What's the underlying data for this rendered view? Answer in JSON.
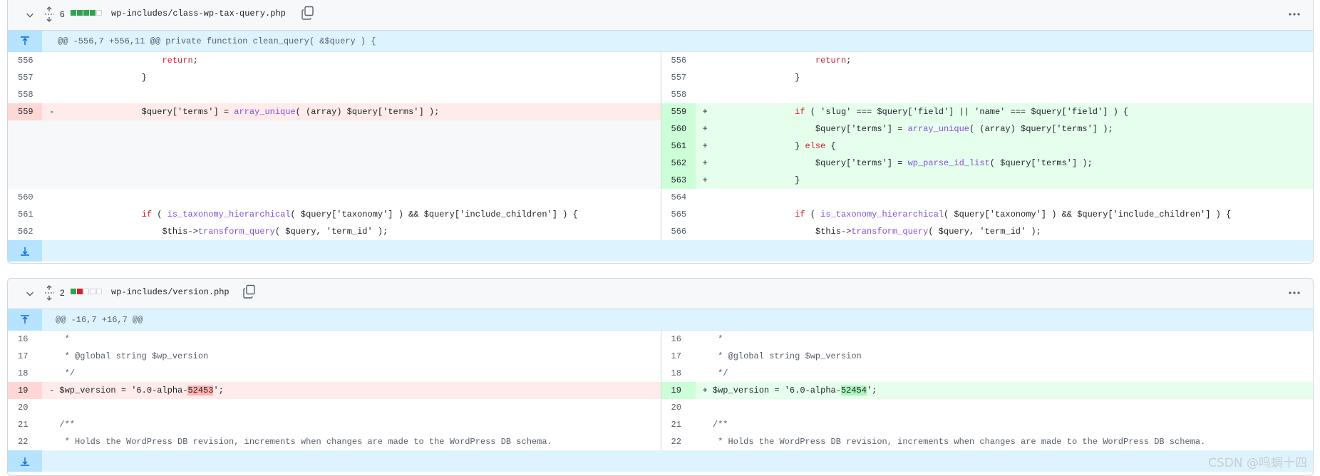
{
  "files": [
    {
      "change_count": "6",
      "stat_blocks": [
        "add",
        "add",
        "add",
        "add",
        "neutral"
      ],
      "filename": "wp-includes/class-wp-tax-query.php",
      "hunk_header": "@@ -556,7 +556,11 @@ private function clean_query( &$query ) {",
      "left_rows": [
        {
          "num": "556",
          "type": "ctx",
          "sign": "",
          "code": "                    return;"
        },
        {
          "num": "557",
          "type": "ctx",
          "sign": "",
          "code": "                }"
        },
        {
          "num": "558",
          "type": "ctx",
          "sign": "",
          "code": ""
        },
        {
          "num": "559",
          "type": "del",
          "sign": "-",
          "code": "                $query['terms'] = array_unique( (array) $query['terms'] );"
        },
        {
          "num": "",
          "type": "empty",
          "sign": "",
          "code": ""
        },
        {
          "num": "",
          "type": "empty",
          "sign": "",
          "code": ""
        },
        {
          "num": "",
          "type": "empty",
          "sign": "",
          "code": ""
        },
        {
          "num": "",
          "type": "empty",
          "sign": "",
          "code": ""
        },
        {
          "num": "560",
          "type": "ctx",
          "sign": "",
          "code": ""
        },
        {
          "num": "561",
          "type": "ctx",
          "sign": "",
          "code": "                if ( is_taxonomy_hierarchical( $query['taxonomy'] ) && $query['include_children'] ) {"
        },
        {
          "num": "562",
          "type": "ctx",
          "sign": "",
          "code": "                    $this->transform_query( $query, 'term_id' );"
        }
      ],
      "right_rows": [
        {
          "num": "556",
          "type": "ctx",
          "sign": "",
          "code": "                    return;"
        },
        {
          "num": "557",
          "type": "ctx",
          "sign": "",
          "code": "                }"
        },
        {
          "num": "558",
          "type": "ctx",
          "sign": "",
          "code": ""
        },
        {
          "num": "559",
          "type": "add",
          "sign": "+",
          "code": "                if ( 'slug' === $query['field'] || 'name' === $query['field'] ) {"
        },
        {
          "num": "560",
          "type": "add",
          "sign": "+",
          "code": "                    $query['terms'] = array_unique( (array) $query['terms'] );"
        },
        {
          "num": "561",
          "type": "add",
          "sign": "+",
          "code": "                } else {"
        },
        {
          "num": "562",
          "type": "add",
          "sign": "+",
          "code": "                    $query['terms'] = wp_parse_id_list( $query['terms'] );"
        },
        {
          "num": "563",
          "type": "add",
          "sign": "+",
          "code": "                }"
        },
        {
          "num": "564",
          "type": "ctx",
          "sign": "",
          "code": ""
        },
        {
          "num": "565",
          "type": "ctx",
          "sign": "",
          "code": "                if ( is_taxonomy_hierarchical( $query['taxonomy'] ) && $query['include_children'] ) {"
        },
        {
          "num": "566",
          "type": "ctx",
          "sign": "",
          "code": "                    $this->transform_query( $query, 'term_id' );"
        }
      ]
    },
    {
      "change_count": "2",
      "stat_blocks": [
        "add",
        "del",
        "neutral",
        "neutral",
        "neutral"
      ],
      "filename": "wp-includes/version.php",
      "hunk_header": "@@ -16,7 +16,7 @@",
      "left_rows": [
        {
          "num": "16",
          "type": "ctx",
          "sign": "",
          "code": " *"
        },
        {
          "num": "17",
          "type": "ctx",
          "sign": "",
          "code": " * @global string $wp_version"
        },
        {
          "num": "18",
          "type": "ctx",
          "sign": "",
          "code": " */"
        },
        {
          "num": "19",
          "type": "del",
          "sign": "-",
          "code": "$wp_version = '6.0-alpha-",
          "hl": "52453",
          "tail": "';"
        },
        {
          "num": "20",
          "type": "ctx",
          "sign": "",
          "code": ""
        },
        {
          "num": "21",
          "type": "ctx",
          "sign": "",
          "code": "/**"
        },
        {
          "num": "22",
          "type": "ctx",
          "sign": "",
          "code": " * Holds the WordPress DB revision, increments when changes are made to the WordPress DB schema."
        }
      ],
      "right_rows": [
        {
          "num": "16",
          "type": "ctx",
          "sign": "",
          "code": " *"
        },
        {
          "num": "17",
          "type": "ctx",
          "sign": "",
          "code": " * @global string $wp_version"
        },
        {
          "num": "18",
          "type": "ctx",
          "sign": "",
          "code": " */"
        },
        {
          "num": "19",
          "type": "add",
          "sign": "+",
          "code": "$wp_version = '6.0-alpha-",
          "hl": "52454",
          "tail": "';"
        },
        {
          "num": "20",
          "type": "ctx",
          "sign": "",
          "code": ""
        },
        {
          "num": "21",
          "type": "ctx",
          "sign": "",
          "code": "/**"
        },
        {
          "num": "22",
          "type": "ctx",
          "sign": "",
          "code": " * Holds the WordPress DB revision, increments when changes are made to the WordPress DB schema."
        }
      ]
    }
  ],
  "watermark": "CSDN @鸣蜩十四",
  "colors": {
    "add": "#2da44e",
    "del": "#cf222e",
    "hunk_bg": "#ddf4ff"
  }
}
